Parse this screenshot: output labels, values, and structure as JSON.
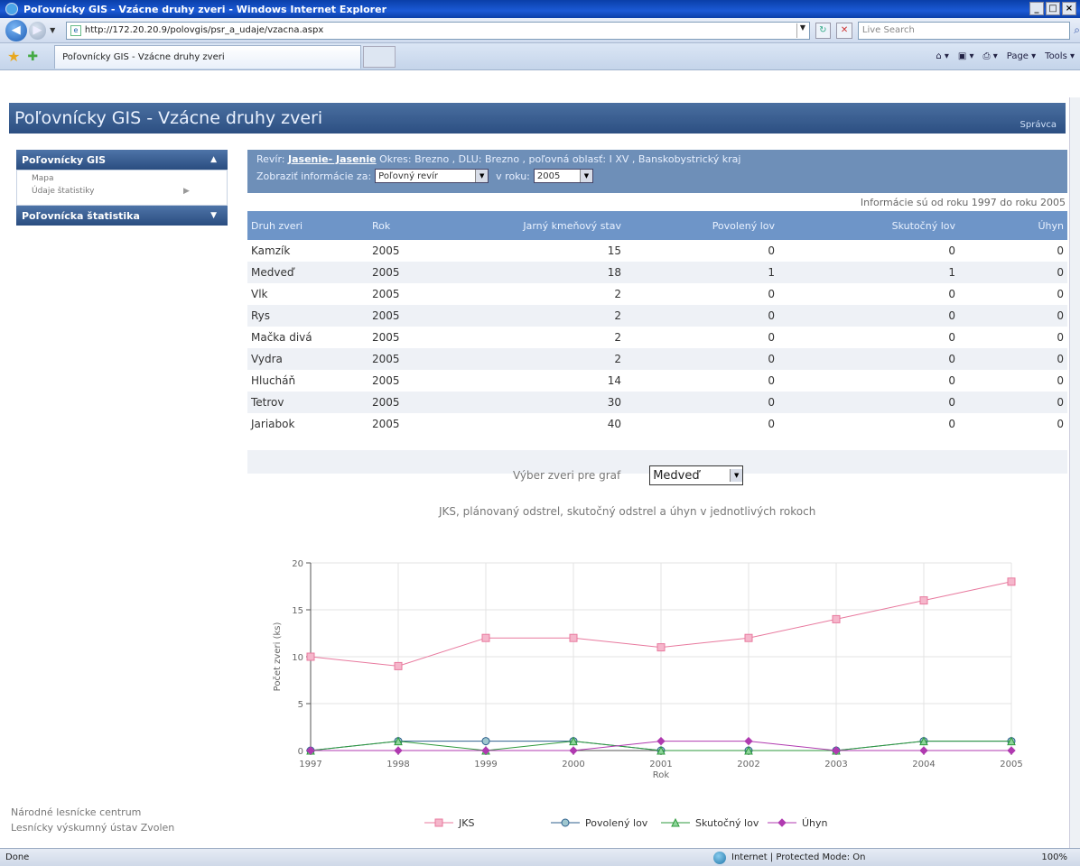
{
  "window": {
    "title": "Poľovnícky GIS - Vzácne druhy zveri - Windows Internet Explorer",
    "url": "http://172.20.20.9/polovgis/psr_a_udaje/vzacna.aspx",
    "search_placeholder": "Live Search",
    "tab_title": "Poľovnícky GIS - Vzácne druhy zveri",
    "cmd_page": "Page",
    "cmd_tools": "Tools"
  },
  "header": {
    "title": "Poľovnícky GIS - Vzácne druhy zveri",
    "admin_link": "Správca"
  },
  "sidebar": {
    "section1_title": "Poľovnícky GIS",
    "items": [
      "Mapa",
      "Údaje štatistiky"
    ],
    "section2_title": "Poľovnícka štatistika"
  },
  "footer": {
    "line1": "Národné lesnícke centrum",
    "line2": "Lesnícky výskumný ústav Zvolen"
  },
  "info": {
    "prefix": "Revír:",
    "revir": "Jasenie- Jasenie",
    "details": "Okres: Brezno , DLU: Brezno , poľovná oblasť: I XV , Banskobystrický kraj",
    "show_label": "Zobraziť informácie za:",
    "show_value": "Poľovný revír",
    "year_label": "v roku:",
    "year_value": "2005",
    "years_note": "Informácie sú od roku 1997 do roku 2005"
  },
  "table": {
    "headers": [
      "Druh zveri",
      "Rok",
      "Jarný kmeňový stav",
      "Povolený lov",
      "Skutočný lov",
      "Úhyn"
    ],
    "rows": [
      [
        "Kamzík",
        "2005",
        "15",
        "0",
        "0",
        "0"
      ],
      [
        "Medveď",
        "2005",
        "18",
        "1",
        "1",
        "0"
      ],
      [
        "Vlk",
        "2005",
        "2",
        "0",
        "0",
        "0"
      ],
      [
        "Rys",
        "2005",
        "2",
        "0",
        "0",
        "0"
      ],
      [
        "Mačka divá",
        "2005",
        "2",
        "0",
        "0",
        "0"
      ],
      [
        "Vydra",
        "2005",
        "2",
        "0",
        "0",
        "0"
      ],
      [
        "Hlucháň",
        "2005",
        "14",
        "0",
        "0",
        "0"
      ],
      [
        "Tetrov",
        "2005",
        "30",
        "0",
        "0",
        "0"
      ],
      [
        "Jariabok",
        "2005",
        "40",
        "0",
        "0",
        "0"
      ]
    ]
  },
  "chart_select": {
    "label": "Výber zveri pre graf",
    "value": "Medveď"
  },
  "chart_data": {
    "type": "line",
    "title": "JKS, plánovaný odstrel, skutočný odstrel a úhyn v jednotlivých rokoch",
    "xlabel": "Rok",
    "ylabel": "Počet zveri (ks)",
    "ylim": [
      0,
      20
    ],
    "yticks": [
      0,
      5,
      10,
      15,
      20
    ],
    "x": [
      "1997",
      "1998",
      "1999",
      "2000",
      "2001",
      "2002",
      "2003",
      "2004",
      "2005"
    ],
    "series": [
      {
        "name": "JKS",
        "color": "#e8799e",
        "marker": "square",
        "values": [
          10,
          9,
          12,
          12,
          11,
          12,
          14,
          16,
          18
        ]
      },
      {
        "name": "Povolený lov",
        "color": "#2c5f8c",
        "marker": "circle",
        "values": [
          0,
          1,
          1,
          1,
          0,
          0,
          0,
          1,
          1
        ]
      },
      {
        "name": "Skutočný lov",
        "color": "#2e9a3c",
        "marker": "triangle",
        "values": [
          0,
          1,
          0,
          1,
          0,
          0,
          0,
          1,
          1
        ]
      },
      {
        "name": "Úhyn",
        "color": "#b03ab0",
        "marker": "diamond",
        "values": [
          0,
          0,
          0,
          0,
          1,
          1,
          0,
          0,
          0
        ]
      }
    ],
    "legend_position": "bottom",
    "grid": true
  },
  "status": {
    "left": "Done",
    "zone": "Internet | Protected Mode: On",
    "zoom": "100%"
  }
}
